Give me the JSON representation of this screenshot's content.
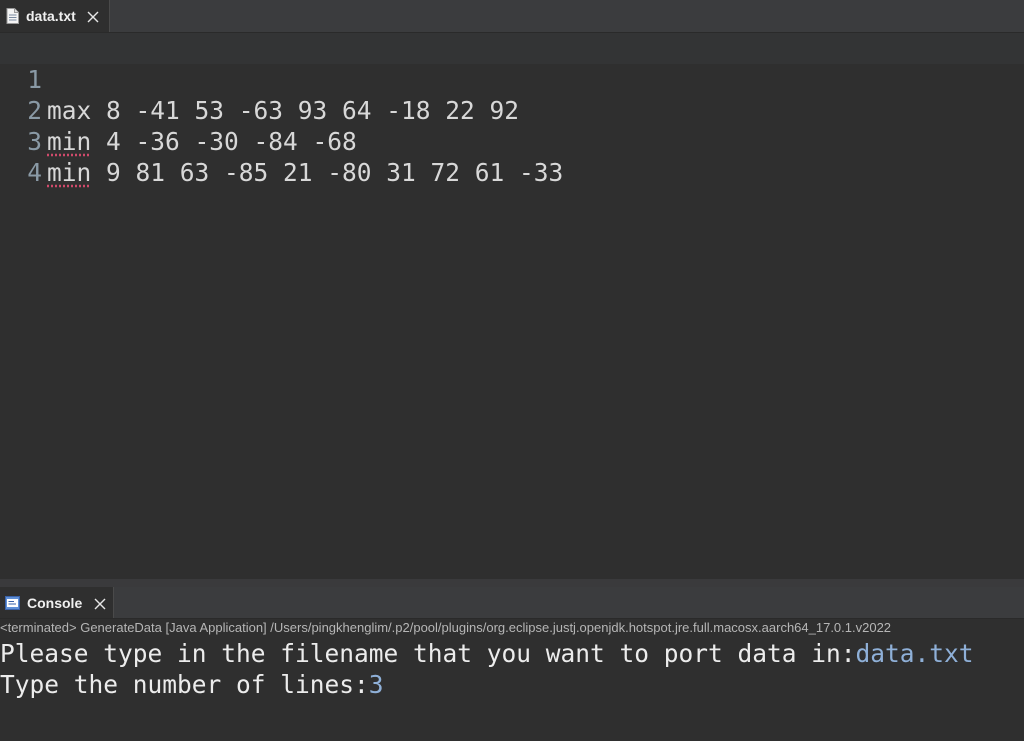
{
  "editor": {
    "tab": {
      "label": "data.txt"
    },
    "lines": [
      {
        "number": "1",
        "keyword": "max",
        "rest": " 8 -41 53 -63 93 64 -18 22 92"
      },
      {
        "number": "2",
        "keyword": "min",
        "rest": " 4 -36 -30 -84 -68"
      },
      {
        "number": "3",
        "keyword": "min",
        "rest": " 9 81 63 -85 21 -80 31 72 61 -33"
      },
      {
        "number": "4",
        "keyword": "",
        "rest": ""
      }
    ]
  },
  "console": {
    "tab": {
      "label": "Console"
    },
    "status": "<terminated> GenerateData [Java Application] /Users/pingkhenglim/.p2/pool/plugins/org.eclipse.justj.openjdk.hotspot.jre.full.macosx.aarch64_17.0.1.v2022",
    "output": [
      {
        "prompt": "Please type in the filename that you want to port data in:",
        "input": "data.txt"
      },
      {
        "prompt": "Type the number of lines:",
        "input": "3"
      }
    ]
  },
  "colors": {
    "background": "#2f2f2f",
    "text": "#d8d8d8",
    "line_number": "#8a9aa6",
    "console_input": "#8fb0d8",
    "spell_underline": "#d04a6b"
  },
  "icons": {
    "editor_tab": "text-file-icon",
    "console_tab": "console-icon",
    "close": "close-icon"
  }
}
